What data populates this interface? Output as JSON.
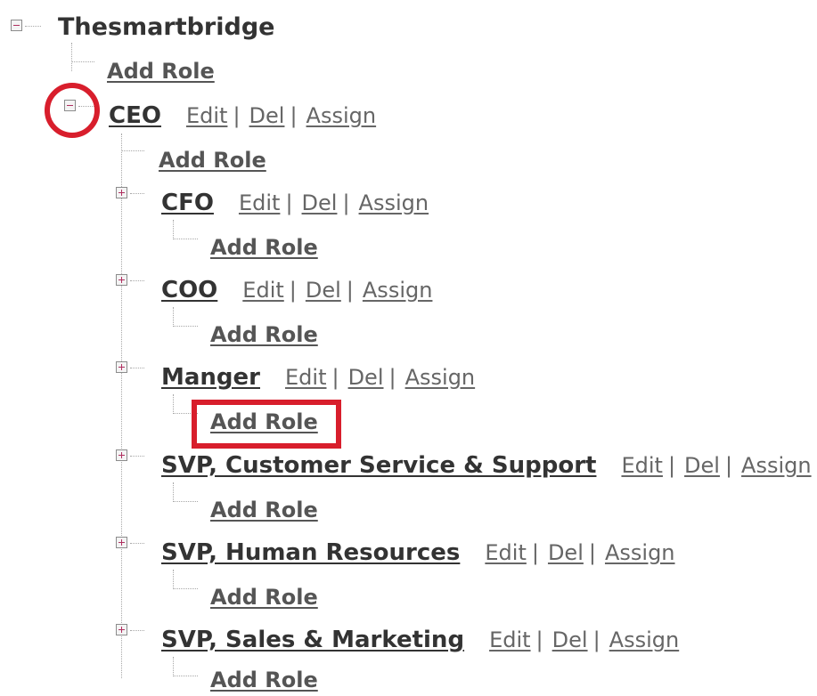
{
  "tree": {
    "root": {
      "label": "Thesmartbridge",
      "toggle": "collapse"
    },
    "add_role_label": "Add Role",
    "actions": {
      "edit": "Edit",
      "del": "Del",
      "assign": "Assign",
      "separator": "|"
    },
    "ceo": {
      "label": "CEO",
      "toggle": "collapse"
    },
    "children": [
      {
        "label": "CFO",
        "toggle": "expand"
      },
      {
        "label": "COO",
        "toggle": "expand"
      },
      {
        "label": "Manger",
        "toggle": "expand"
      },
      {
        "label": "SVP, Customer Service & Support",
        "toggle": "expand"
      },
      {
        "label": "SVP, Human Resources",
        "toggle": "expand"
      },
      {
        "label": "SVP, Sales & Marketing",
        "toggle": "expand"
      }
    ]
  },
  "annotations": {
    "circle_color": "#d81e2c",
    "rect_color": "#d81e2c"
  }
}
